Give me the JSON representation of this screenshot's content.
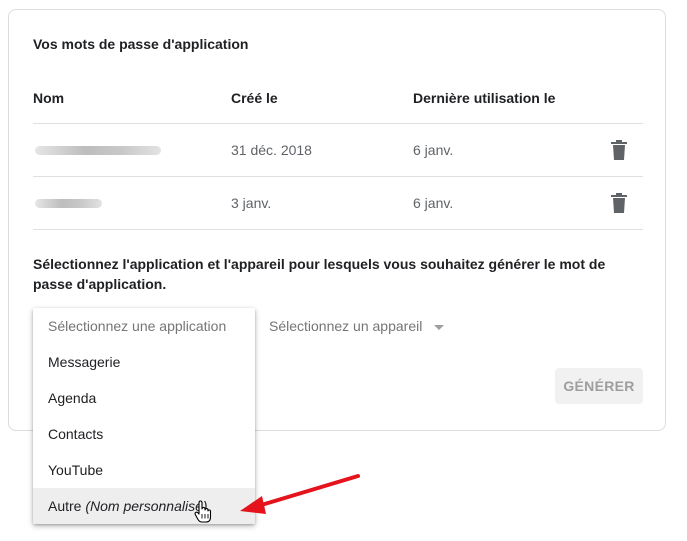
{
  "section": {
    "title": "Vos mots de passe d'application"
  },
  "table": {
    "headers": [
      "Nom",
      "Créé le",
      "Dernière utilisation le"
    ],
    "rows": [
      {
        "created": "31 déc. 2018",
        "last_used": "6 janv."
      },
      {
        "created": "3 janv.",
        "last_used": "6 janv."
      }
    ],
    "delete_icon": "trash-icon"
  },
  "prompt": "Sélectionnez l'application et l'appareil pour lesquels vous souhaitez générer le mot de passe d'application.",
  "app_dropdown": {
    "placeholder": "Sélectionnez une application",
    "options": [
      "Messagerie",
      "Agenda",
      "Contacts",
      "YouTube"
    ],
    "custom_option": {
      "label": "Autre",
      "hint": "(Nom personnalisé)"
    },
    "highlighted_option": "Autre (Nom personnalisé)"
  },
  "device_select": {
    "placeholder": "Sélectionnez un appareil"
  },
  "generate_button": {
    "label": "GÉNÉRER"
  },
  "annotation": {
    "arrow_color": "#e5131b"
  }
}
